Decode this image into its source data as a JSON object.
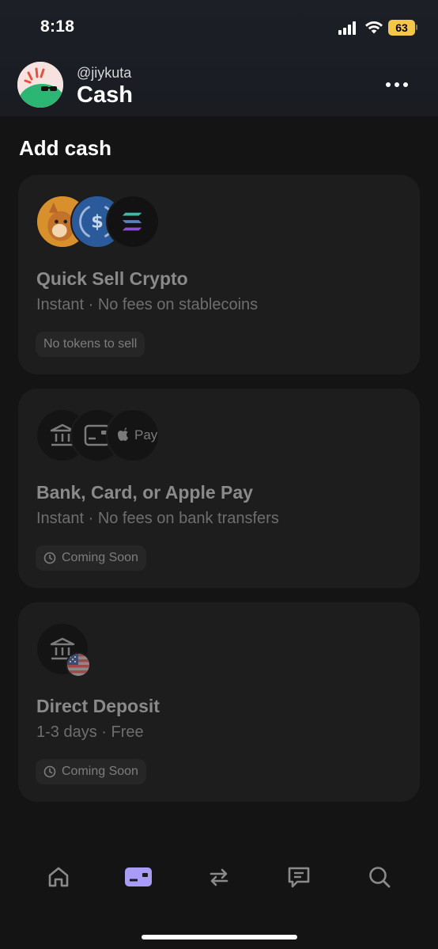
{
  "status_bar": {
    "time": "8:18",
    "battery": "63"
  },
  "header": {
    "username": "@jiykuta",
    "title": "Cash"
  },
  "section": {
    "title": "Add cash"
  },
  "cards": [
    {
      "title": "Quick Sell Crypto",
      "subtitle": "Instant · No fees on stablecoins",
      "pill": "No tokens to sell",
      "icons": [
        "dog-token-icon",
        "usdc-icon",
        "solana-icon"
      ]
    },
    {
      "title": "Bank, Card, or Apple Pay",
      "subtitle": "Instant · No fees on bank transfers",
      "pill": "Coming Soon",
      "icons": [
        "bank-icon",
        "card-icon",
        "apple-pay-icon"
      ],
      "apple_pay_label": "Pay"
    },
    {
      "title": "Direct Deposit",
      "subtitle": "1-3 days · Free",
      "pill": "Coming Soon",
      "icons": [
        "bank-icon",
        "us-flag-icon"
      ]
    }
  ],
  "tabs": [
    "home-icon",
    "cash-icon",
    "swap-icon",
    "chat-icon",
    "search-icon"
  ],
  "colors": {
    "accent": "#a99cf7",
    "background": "#141414",
    "card": "#1d1d1d",
    "battery": "#f4c64a",
    "avatar_green": "#2bb673"
  }
}
